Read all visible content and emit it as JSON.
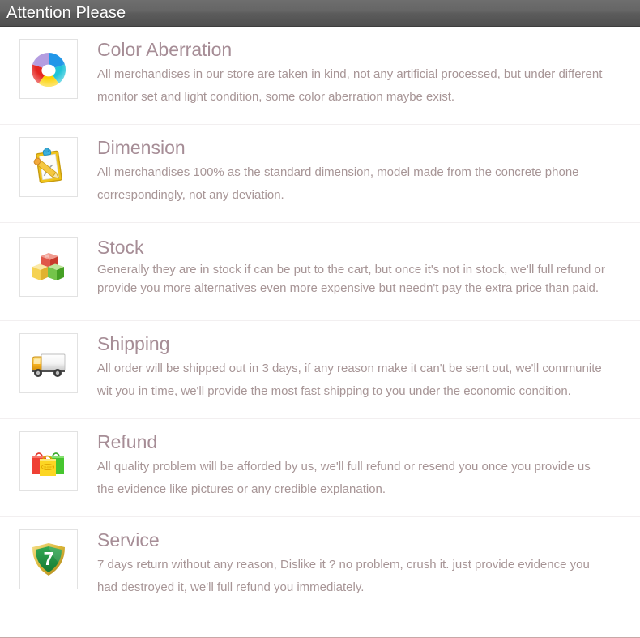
{
  "header": {
    "title": "Attention Please",
    "bg_color": "#5e5e5e",
    "text_color": "#ffffff"
  },
  "theme": {
    "title_color": "#a68d96",
    "body_color": "#a79596",
    "divider_color": "#f2eff0",
    "icon_border_color": "#e2e2e2",
    "page_bg": "#ffffff"
  },
  "sections": [
    {
      "id": "color-aberration",
      "icon_name": "color-wheel-icon",
      "title": "Color Aberration",
      "line1": "All merchandises in our store are taken in kind, not any artificial processed, but under different",
      "line2": "monitor set and light condition, some color aberration maybe exist."
    },
    {
      "id": "dimension",
      "icon_name": "clipboard-pencil-icon",
      "title": "Dimension",
      "line1": "All merchandises 100% as the standard dimension, model made from the concrete phone",
      "line2": "correspondingly, not any deviation."
    },
    {
      "id": "stock",
      "icon_name": "boxes-icon",
      "title": "Stock",
      "line1": "Generally they are in stock if can be put to the cart, but once it's not in stock, we'll full refund or",
      "line2": "provide you more alternatives even more expensive but needn't pay the extra price than paid."
    },
    {
      "id": "shipping",
      "icon_name": "delivery-truck-icon",
      "title": "Shipping",
      "line1": "All order will be shipped out in 3 days, if any reason make it can't be sent out, we'll communite",
      "line2": "wit you in time, we'll provide the most fast shipping to you under the economic condition."
    },
    {
      "id": "refund",
      "icon_name": "shopping-bags-icon",
      "title": "Refund",
      "line1": "All quality problem will be afforded by us, we'll full refund or resend you once you provide us",
      "line2": "the evidence like pictures or any credible explanation."
    },
    {
      "id": "service",
      "icon_name": "seven-day-shield-icon",
      "title": "Service",
      "line1": "7 days return without any reason, Dislike it ? no problem, crush it. just provide evidence you",
      "line2": "had destroyed it, we'll full refund you immediately."
    }
  ]
}
